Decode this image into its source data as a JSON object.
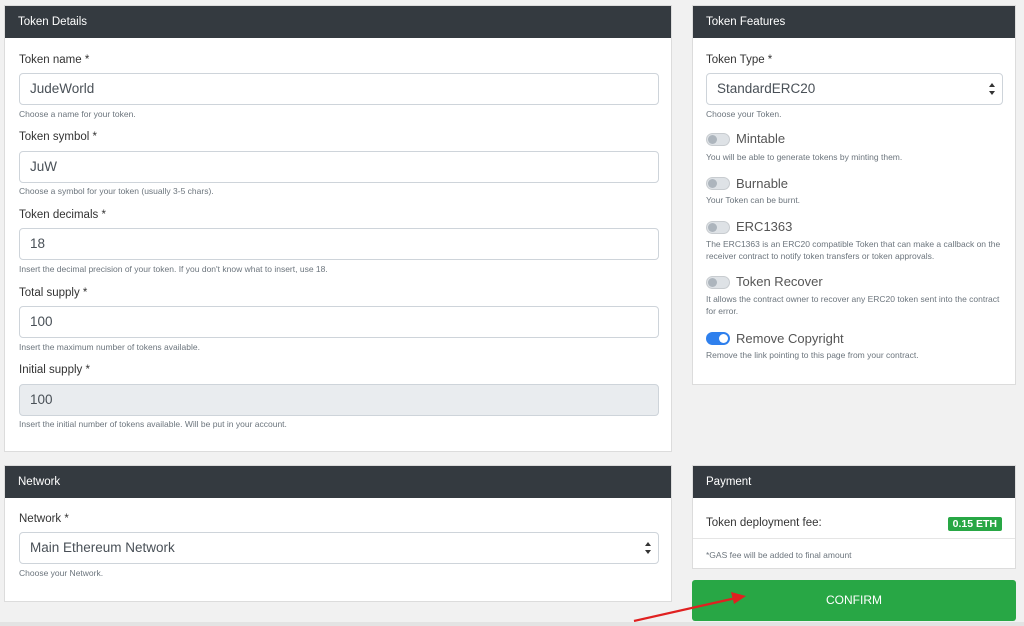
{
  "token_details": {
    "header": "Token Details",
    "name_label": "Token name *",
    "name_value": "JudeWorld",
    "name_help": "Choose a name for your token.",
    "symbol_label": "Token symbol *",
    "symbol_value": "JuW",
    "symbol_help": "Choose a symbol for your token (usually 3-5 chars).",
    "decimals_label": "Token decimals *",
    "decimals_value": "18",
    "decimals_help": "Insert the decimal precision of your token. If you don't know what to insert, use 18.",
    "total_label": "Total supply *",
    "total_value": "100",
    "total_help": "Insert the maximum number of tokens available.",
    "initial_label": "Initial supply *",
    "initial_value": "100",
    "initial_help": "Insert the initial number of tokens available. Will be put in your account."
  },
  "token_features": {
    "header": "Token Features",
    "type_label": "Token Type *",
    "type_value": "StandardERC20",
    "type_help": "Choose your Token.",
    "toggles": [
      {
        "label": "Mintable",
        "help": "You will be able to generate tokens by minting them.",
        "on": false
      },
      {
        "label": "Burnable",
        "help": "Your Token can be burnt.",
        "on": false
      },
      {
        "label": "ERC1363",
        "help_line1": "The ERC1363 is an ERC20 compatible Token that can make a callback on the",
        "help_line2": "receiver contract to notify token transfers or token approvals.",
        "on": false
      },
      {
        "label": "Token Recover",
        "help_line1": "It allows the contract owner to recover any ERC20 token sent into the contract",
        "help_line2": "for error.",
        "on": false
      },
      {
        "label": "Remove Copyright",
        "help": "Remove the link pointing to this page from your contract.",
        "on": true
      }
    ]
  },
  "network": {
    "header": "Network",
    "label": "Network *",
    "value": "Main Ethereum Network",
    "help": "Choose your Network."
  },
  "payment": {
    "header": "Payment",
    "fee_label": "Token deployment fee:",
    "fee_value": "0.15 ETH",
    "gas_note": "*GAS fee will be added to final amount"
  },
  "confirm_label": "CONFIRM",
  "colors": {
    "header_bg": "#343a40",
    "confirm_green": "#28a745",
    "toggle_on": "#2f80ed",
    "arrow_red": "#e02020"
  },
  "icons": [
    "select-caret-icon",
    "annotation-arrow-icon"
  ]
}
